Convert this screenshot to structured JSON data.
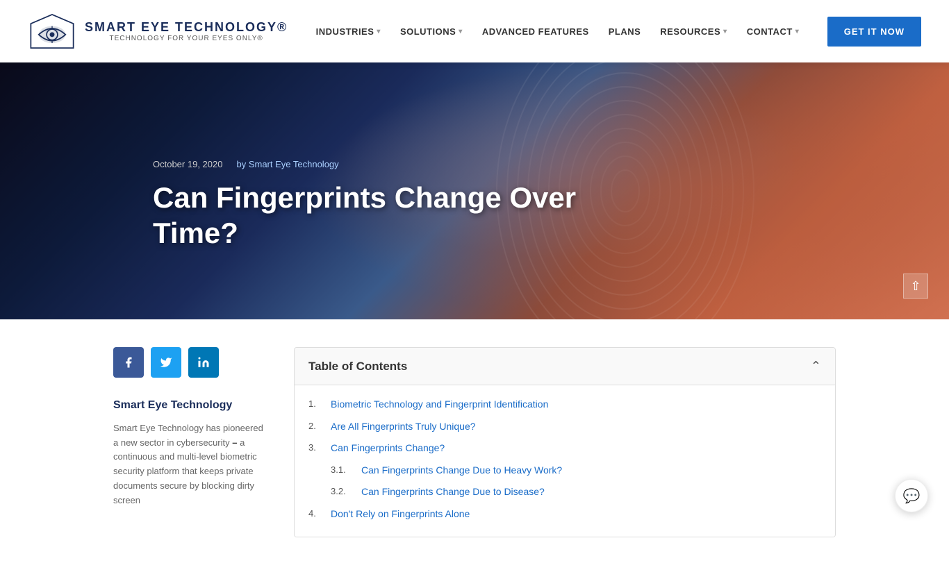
{
  "navbar": {
    "logo": {
      "brand": "SMART EYE TECHNOLOGY®",
      "tagline": "TECHNOLOGY FOR YOUR EYES ONLY®"
    },
    "nav_items": [
      {
        "label": "INDUSTRIES",
        "has_dropdown": true
      },
      {
        "label": "SOLUTIONS",
        "has_dropdown": true
      },
      {
        "label": "ADVANCED FEATURES",
        "has_dropdown": false
      },
      {
        "label": "PLANS",
        "has_dropdown": false
      },
      {
        "label": "RESOURCES",
        "has_dropdown": true
      },
      {
        "label": "CONTACT",
        "has_dropdown": true
      }
    ],
    "cta_label": "GET IT NOW"
  },
  "hero": {
    "date": "October 19, 2020",
    "author_prefix": "by",
    "author": "Smart Eye Technology",
    "title": "Can Fingerprints Change Over Time?"
  },
  "sidebar": {
    "share": {
      "facebook_label": "f",
      "twitter_label": "t",
      "linkedin_label": "in"
    },
    "author_name": "Smart Eye Technology",
    "author_bio_1": "Smart Eye Technology has pioneered a new sector in cybersecurity",
    "author_bio_dash": " – ",
    "author_bio_2": "a continuous and multi-level biometric security platform that keeps private documents secure by blocking dirty screen"
  },
  "toc": {
    "title": "Table of Contents",
    "items": [
      {
        "num": "1.",
        "text": "Biometric Technology and Fingerprint Identification",
        "sub": false
      },
      {
        "num": "2.",
        "text": "Are All Fingerprints Truly Unique?",
        "sub": false
      },
      {
        "num": "3.",
        "text": "Can Fingerprints Change?",
        "sub": false
      },
      {
        "num": "3.1.",
        "text": "Can Fingerprints Change Due to Heavy Work?",
        "sub": true
      },
      {
        "num": "3.2.",
        "text": "Can Fingerprints Change Due to Disease?",
        "sub": true
      },
      {
        "num": "4.",
        "text": "Don't Rely on Fingerprints Alone",
        "sub": false
      }
    ]
  },
  "chat": {
    "icon": "💬"
  }
}
